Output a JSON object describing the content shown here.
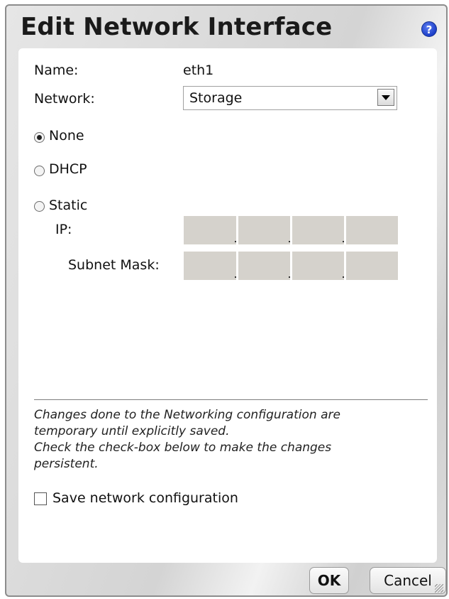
{
  "dialog": {
    "title": "Edit Network Interface",
    "help_icon_glyph": "?"
  },
  "form": {
    "name_label": "Name:",
    "name_value": "eth1",
    "network_label": "Network:",
    "network_value": "Storage",
    "radio_options": [
      {
        "label": "None",
        "checked": true
      },
      {
        "label": "DHCP",
        "checked": false
      },
      {
        "label": "Static",
        "checked": false
      }
    ],
    "ip_label": "IP:",
    "subnet_label": "Subnet Mask:"
  },
  "note": {
    "line1": "Changes done to the Networking configuration are",
    "line2": "temporary until explicitly saved.",
    "line3": "Check the check-box below to make the changes",
    "line4": "persistent."
  },
  "save_checkbox": {
    "label": "Save network configuration",
    "checked": false
  },
  "buttons": {
    "ok": "OK",
    "cancel": "Cancel"
  }
}
